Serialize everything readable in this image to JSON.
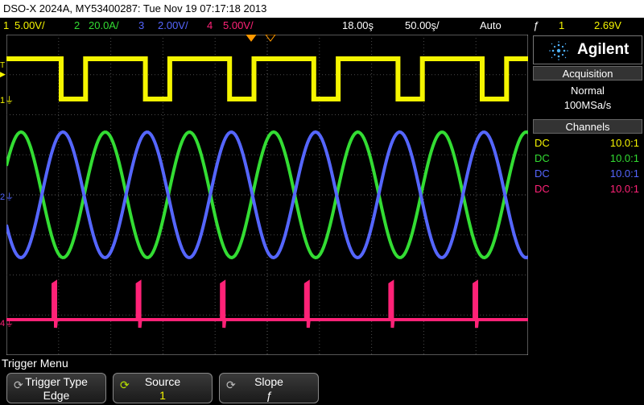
{
  "title_bar": "DSO-X 2024A, MY53400287: Tue Nov 19 07:17:18 2013",
  "status": {
    "ch1": {
      "num": "1",
      "scale": "5.00V/",
      "color": "#f5f500"
    },
    "ch2": {
      "num": "2",
      "scale": "20.0A/",
      "color": "#33dd33"
    },
    "ch3": {
      "num": "3",
      "scale": "2.00V/",
      "color": "#5566ff"
    },
    "ch4": {
      "num": "4",
      "scale": "5.00V/",
      "color": "#ff2277"
    },
    "delay": "18.00ş",
    "timebase": "50.00ş/",
    "trigger_mode": "Auto",
    "trigger_slope_icon": "ƒ",
    "trigger_source": "1",
    "trigger_level": "2.69V"
  },
  "brand": {
    "name": "Agilent",
    "icon": "agilent-spark-icon"
  },
  "acquisition": {
    "header": "Acquisition",
    "mode": "Normal",
    "rate": "100MSa/s"
  },
  "channels": {
    "header": "Channels",
    "rows": [
      {
        "coupling": "DC",
        "probe": "10.0:1",
        "color": "#f5f500"
      },
      {
        "coupling": "DC",
        "probe": "10.0:1",
        "color": "#33dd33"
      },
      {
        "coupling": "DC",
        "probe": "10.0:1",
        "color": "#5566ff"
      },
      {
        "coupling": "DC",
        "probe": "10.0:1",
        "color": "#ff2277"
      }
    ]
  },
  "markers": {
    "t": "T",
    "ch1": "1",
    "ch2": "2",
    "ch4": "4"
  },
  "menu": {
    "title": "Trigger Menu",
    "softkeys": [
      {
        "label": "Trigger Type",
        "value": "Edge"
      },
      {
        "label": "Source",
        "value": "1"
      },
      {
        "label": "Slope",
        "value": "ƒ"
      }
    ]
  }
}
